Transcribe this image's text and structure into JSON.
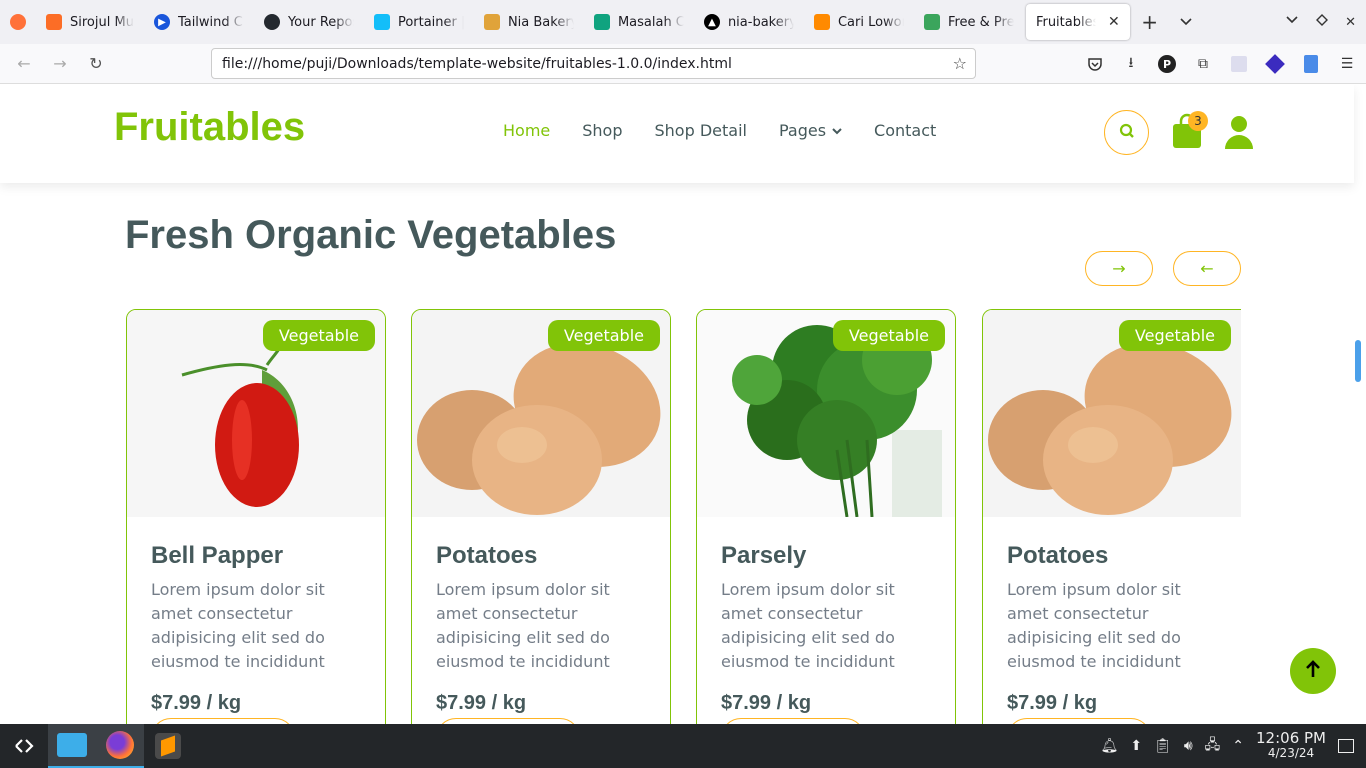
{
  "browser": {
    "tabs": [
      {
        "title": "",
        "color": "#ff7139",
        "icon": "firefox-icon"
      },
      {
        "title": "Sirojul Mu",
        "color": "#fc6d26",
        "icon": "gitlab-icon"
      },
      {
        "title": "Tailwind CS",
        "color": "#1a56db",
        "icon": "play-icon"
      },
      {
        "title": "Your Repos",
        "color": "#24292f",
        "icon": "github-icon"
      },
      {
        "title": "Portainer |",
        "color": "#13bef9",
        "icon": "portainer-icon"
      },
      {
        "title": "Nia Bakery",
        "color": "#e0a33a",
        "icon": "bakery-icon"
      },
      {
        "title": "Masalah Co",
        "color": "#10a37f",
        "icon": "chatgpt-icon"
      },
      {
        "title": "nia-bakery",
        "color": "#000000",
        "icon": "vercel-icon"
      },
      {
        "title": "Cari Lowon",
        "color": "#ff8a00",
        "icon": "jobs-icon"
      },
      {
        "title": "Free & Pre",
        "color": "#3ba55c",
        "icon": "leaf-icon"
      }
    ],
    "active_tab": "Fruitables - V",
    "url": "file:///home/puji/Downloads/template-website/fruitables-1.0.0/index.html"
  },
  "site": {
    "brand": "Fruitables",
    "menu": [
      "Home",
      "Shop",
      "Shop Detail",
      "Pages",
      "Contact"
    ],
    "cart_count": "3",
    "accent": "#81c408",
    "secondary": "#ffb524"
  },
  "section": {
    "title": "Fresh Organic Vegetables",
    "next_arrow": "→",
    "prev_arrow": "←"
  },
  "products": [
    {
      "tag": "Vegetable",
      "name": "Bell Papper",
      "desc": "Lorem ipsum dolor sit amet consectetur adipisicing elit sed do eiusmod te incididunt",
      "price": "$7.99 / kg",
      "image": "bell-pepper"
    },
    {
      "tag": "Vegetable",
      "name": "Potatoes",
      "desc": "Lorem ipsum dolor sit amet consectetur adipisicing elit sed do eiusmod te incididunt",
      "price": "$7.99 / kg",
      "image": "potatoes"
    },
    {
      "tag": "Vegetable",
      "name": "Parsely",
      "desc": "Lorem ipsum dolor sit amet consectetur adipisicing elit sed do eiusmod te incididunt",
      "price": "$7.99 / kg",
      "image": "parsley"
    },
    {
      "tag": "Vegetable",
      "name": "Potatoes",
      "desc": "Lorem ipsum dolor sit amet consectetur adipisicing elit sed do eiusmod te incididunt",
      "price": "$7.99 / kg",
      "image": "potatoes"
    }
  ],
  "taskbar": {
    "time": "12:06 PM",
    "date": "4/23/24"
  }
}
